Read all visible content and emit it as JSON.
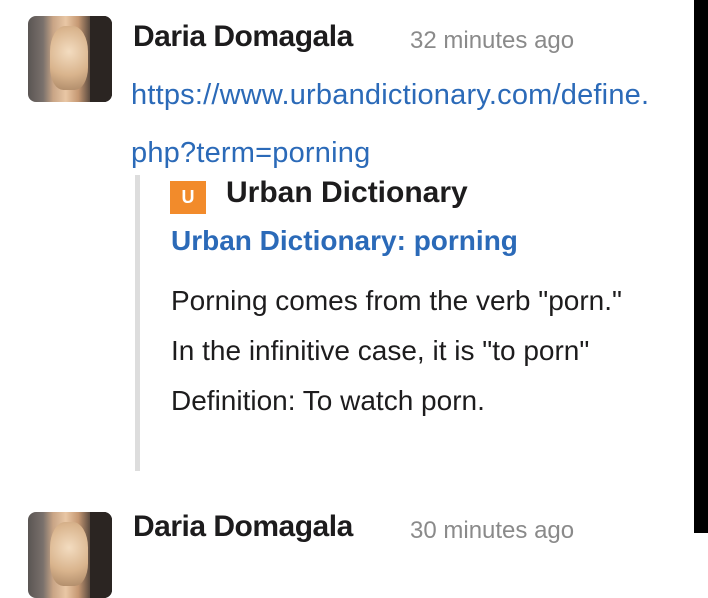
{
  "messages": [
    {
      "sender": "Daria Domagala",
      "timestamp": "32 minutes ago",
      "link": "https://www.urbandictionary.com/define.php?term=porning",
      "attachment": {
        "service_name": "Urban Dictionary",
        "service_icon": "urban-dictionary-logo-icon",
        "title": "Urban Dictionary: porning",
        "description": "Porning comes from the verb \"porn.\" In the infinitive case, it is \"to porn\" Definition: To watch porn."
      }
    },
    {
      "sender": "Daria Domagala",
      "timestamp": "30 minutes ago"
    }
  ],
  "colors": {
    "link": "#2b6ab8",
    "text": "#1d1c1d",
    "muted": "#8a8a8a",
    "logo": "#f28b2b",
    "attachment_bar": "#dddddd"
  }
}
